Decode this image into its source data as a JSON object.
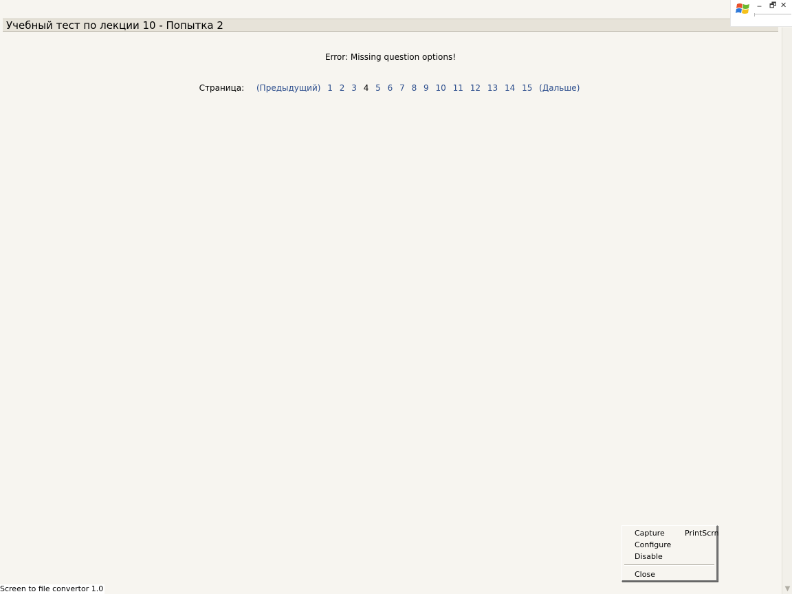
{
  "page": {
    "title": "Учебный тест по лекции 10 - Попытка 2",
    "error_message": "Error: Missing question options!"
  },
  "pager": {
    "label": "Страница:",
    "prev": "(Предыдущий)",
    "next": "(Дальше)",
    "current_page": 4,
    "pages": [
      "1",
      "2",
      "3",
      "4",
      "5",
      "6",
      "7",
      "8",
      "9",
      "10",
      "11",
      "12",
      "13",
      "14",
      "15"
    ]
  },
  "window_controls": {
    "minimize": "‒",
    "restore": "🗗",
    "close": "✕"
  },
  "context_menu": {
    "items": [
      {
        "label": "Capture",
        "shortcut": "PrintScrn"
      },
      {
        "label": "Configure"
      },
      {
        "label": "Disable"
      },
      {
        "label": "Close"
      }
    ]
  },
  "status": {
    "text": "Screen to file convertor 1.0"
  },
  "colors": {
    "background": "#f7f5f0",
    "title_bar": "#e7e3d9",
    "link": "#2a4c8c"
  },
  "icons": [
    "windows-logo-icon",
    "minimize-icon",
    "restore-icon",
    "close-icon",
    "scroll-down-arrow-icon"
  ]
}
